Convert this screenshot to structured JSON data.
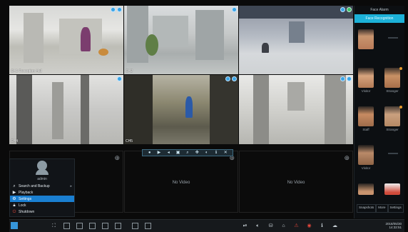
{
  "cameras": [
    {
      "channel": "CH1  Reception Hall",
      "badges": [
        "blue",
        "blue"
      ]
    },
    {
      "channel": "CH2",
      "badges": [
        "blue"
      ]
    },
    {
      "channel": "",
      "badges": [
        "blue",
        "green"
      ]
    },
    {
      "channel": "CH4",
      "badges": [
        "blue"
      ]
    },
    {
      "channel": "CH5",
      "badges": [
        "blue",
        "blue"
      ]
    },
    {
      "channel": "",
      "badges": [
        "blue",
        "blue"
      ]
    }
  ],
  "empty_cells": [
    {
      "label": ""
    },
    {
      "label": "No Video"
    },
    {
      "label": "No Video"
    }
  ],
  "start_menu": {
    "user_name": "admin",
    "items": [
      {
        "label": "Search and Backup",
        "icon": "search-icon",
        "active": false,
        "arrow": "▸"
      },
      {
        "label": "Playback",
        "icon": "playback-icon",
        "active": false,
        "arrow": ""
      },
      {
        "label": "Settings",
        "icon": "settings-icon",
        "active": true,
        "arrow": ""
      },
      {
        "label": "Lock",
        "icon": "lock-icon",
        "active": false,
        "arrow": ""
      },
      {
        "label": "Shutdown",
        "icon": "power-icon",
        "active": false,
        "arrow": ""
      }
    ]
  },
  "right_panel": {
    "title": "Face Alarm",
    "header": "Face Recognition",
    "faces": [
      {
        "left_caption": "",
        "right_caption": ""
      },
      {
        "left_caption": "Visitor",
        "right_caption": "Stranger"
      },
      {
        "left_caption": "Staff",
        "right_caption": "Stranger"
      },
      {
        "left_caption": "Visitor",
        "right_caption": ""
      },
      {
        "left_caption": "",
        "right_caption": ""
      }
    ],
    "footer": {
      "left_label": "Snapshots",
      "middle_label": "More",
      "right_label": "Settings"
    }
  },
  "taskbar": {
    "time_line1": "2018/05/30",
    "time_line2": "14:32:51"
  },
  "colors": {
    "accent_blue": "#1a7fd1",
    "panel_header": "#1cb1d8",
    "badge_blue": "#3aa5e6",
    "badge_green": "#3cc06a"
  }
}
